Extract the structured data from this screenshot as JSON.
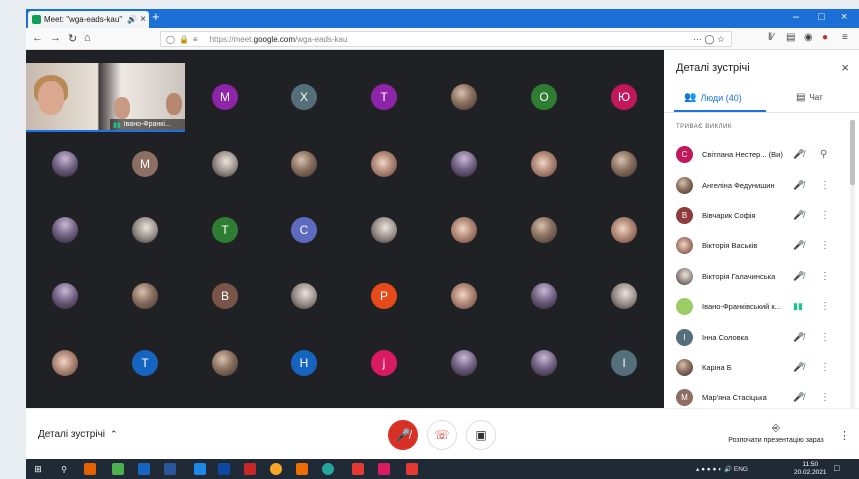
{
  "browser": {
    "tab_title": "Meet: \"wga-eads-kau\"",
    "url_prefix": "https://meet.",
    "url_domain": "google.com",
    "url_path": "/wga-eads-kau",
    "page_actions": "···"
  },
  "meet": {
    "self_label": "Івано-Франкі...",
    "tiles": {
      "r0": [
        "M",
        "X",
        "T",
        "O",
        "Ю"
      ],
      "r1_initial": "M",
      "r2": [
        "T",
        "C"
      ],
      "r3": [
        "B",
        "P"
      ],
      "r4": [
        "T",
        "H",
        "j",
        "I"
      ]
    },
    "tile_colors": {
      "M": "#8e24aa",
      "X": "#546e7a",
      "T_purple": "#8e24aa",
      "O": "#2e7d32",
      "Ю": "#c2185b",
      "M2": "#8d6e63",
      "T_green": "#2e7d32",
      "C": "#5c6bc0",
      "B": "#795548",
      "P": "#e64a19",
      "T_blue": "#1565c0",
      "H": "#1565c0",
      "j": "#d81b60",
      "I": "#546e7a"
    }
  },
  "panel": {
    "title": "Деталі зустрічі",
    "tab_people": "Люди (40)",
    "tab_chat": "Чат",
    "section": "ТРИВАЄ ВИКЛИК",
    "people": [
      {
        "name": "Світлана Нестер... (Ви)",
        "initial": "С",
        "color": "#c2185b"
      },
      {
        "name": "Ангеліна Федунишин",
        "initial": "",
        "color": "#6d4c41"
      },
      {
        "name": "Вівчарик Софія",
        "initial": "В",
        "color": "#8d3b3b"
      },
      {
        "name": "Вікторія Васьків",
        "initial": "",
        "color": "#a1887f"
      },
      {
        "name": "Вікторія Галачинська",
        "initial": "",
        "color": "#4e342e"
      },
      {
        "name": "Івано-Франківський к...",
        "initial": "",
        "color": "#9ccc65"
      },
      {
        "name": "Інна Соловка",
        "initial": "І",
        "color": "#546e7a"
      },
      {
        "name": "Каріна Б",
        "initial": "",
        "color": "#7e6f6a"
      },
      {
        "name": "Мар'яна Стасіцька",
        "initial": "М",
        "color": "#8d6e63"
      }
    ]
  },
  "controls": {
    "meeting_details": "Деталі зустрічі",
    "present": "Розпочати презентацію зараз"
  },
  "taskbar": {
    "lang": "ENG",
    "time": "11:50",
    "date": "20.02.2021"
  }
}
